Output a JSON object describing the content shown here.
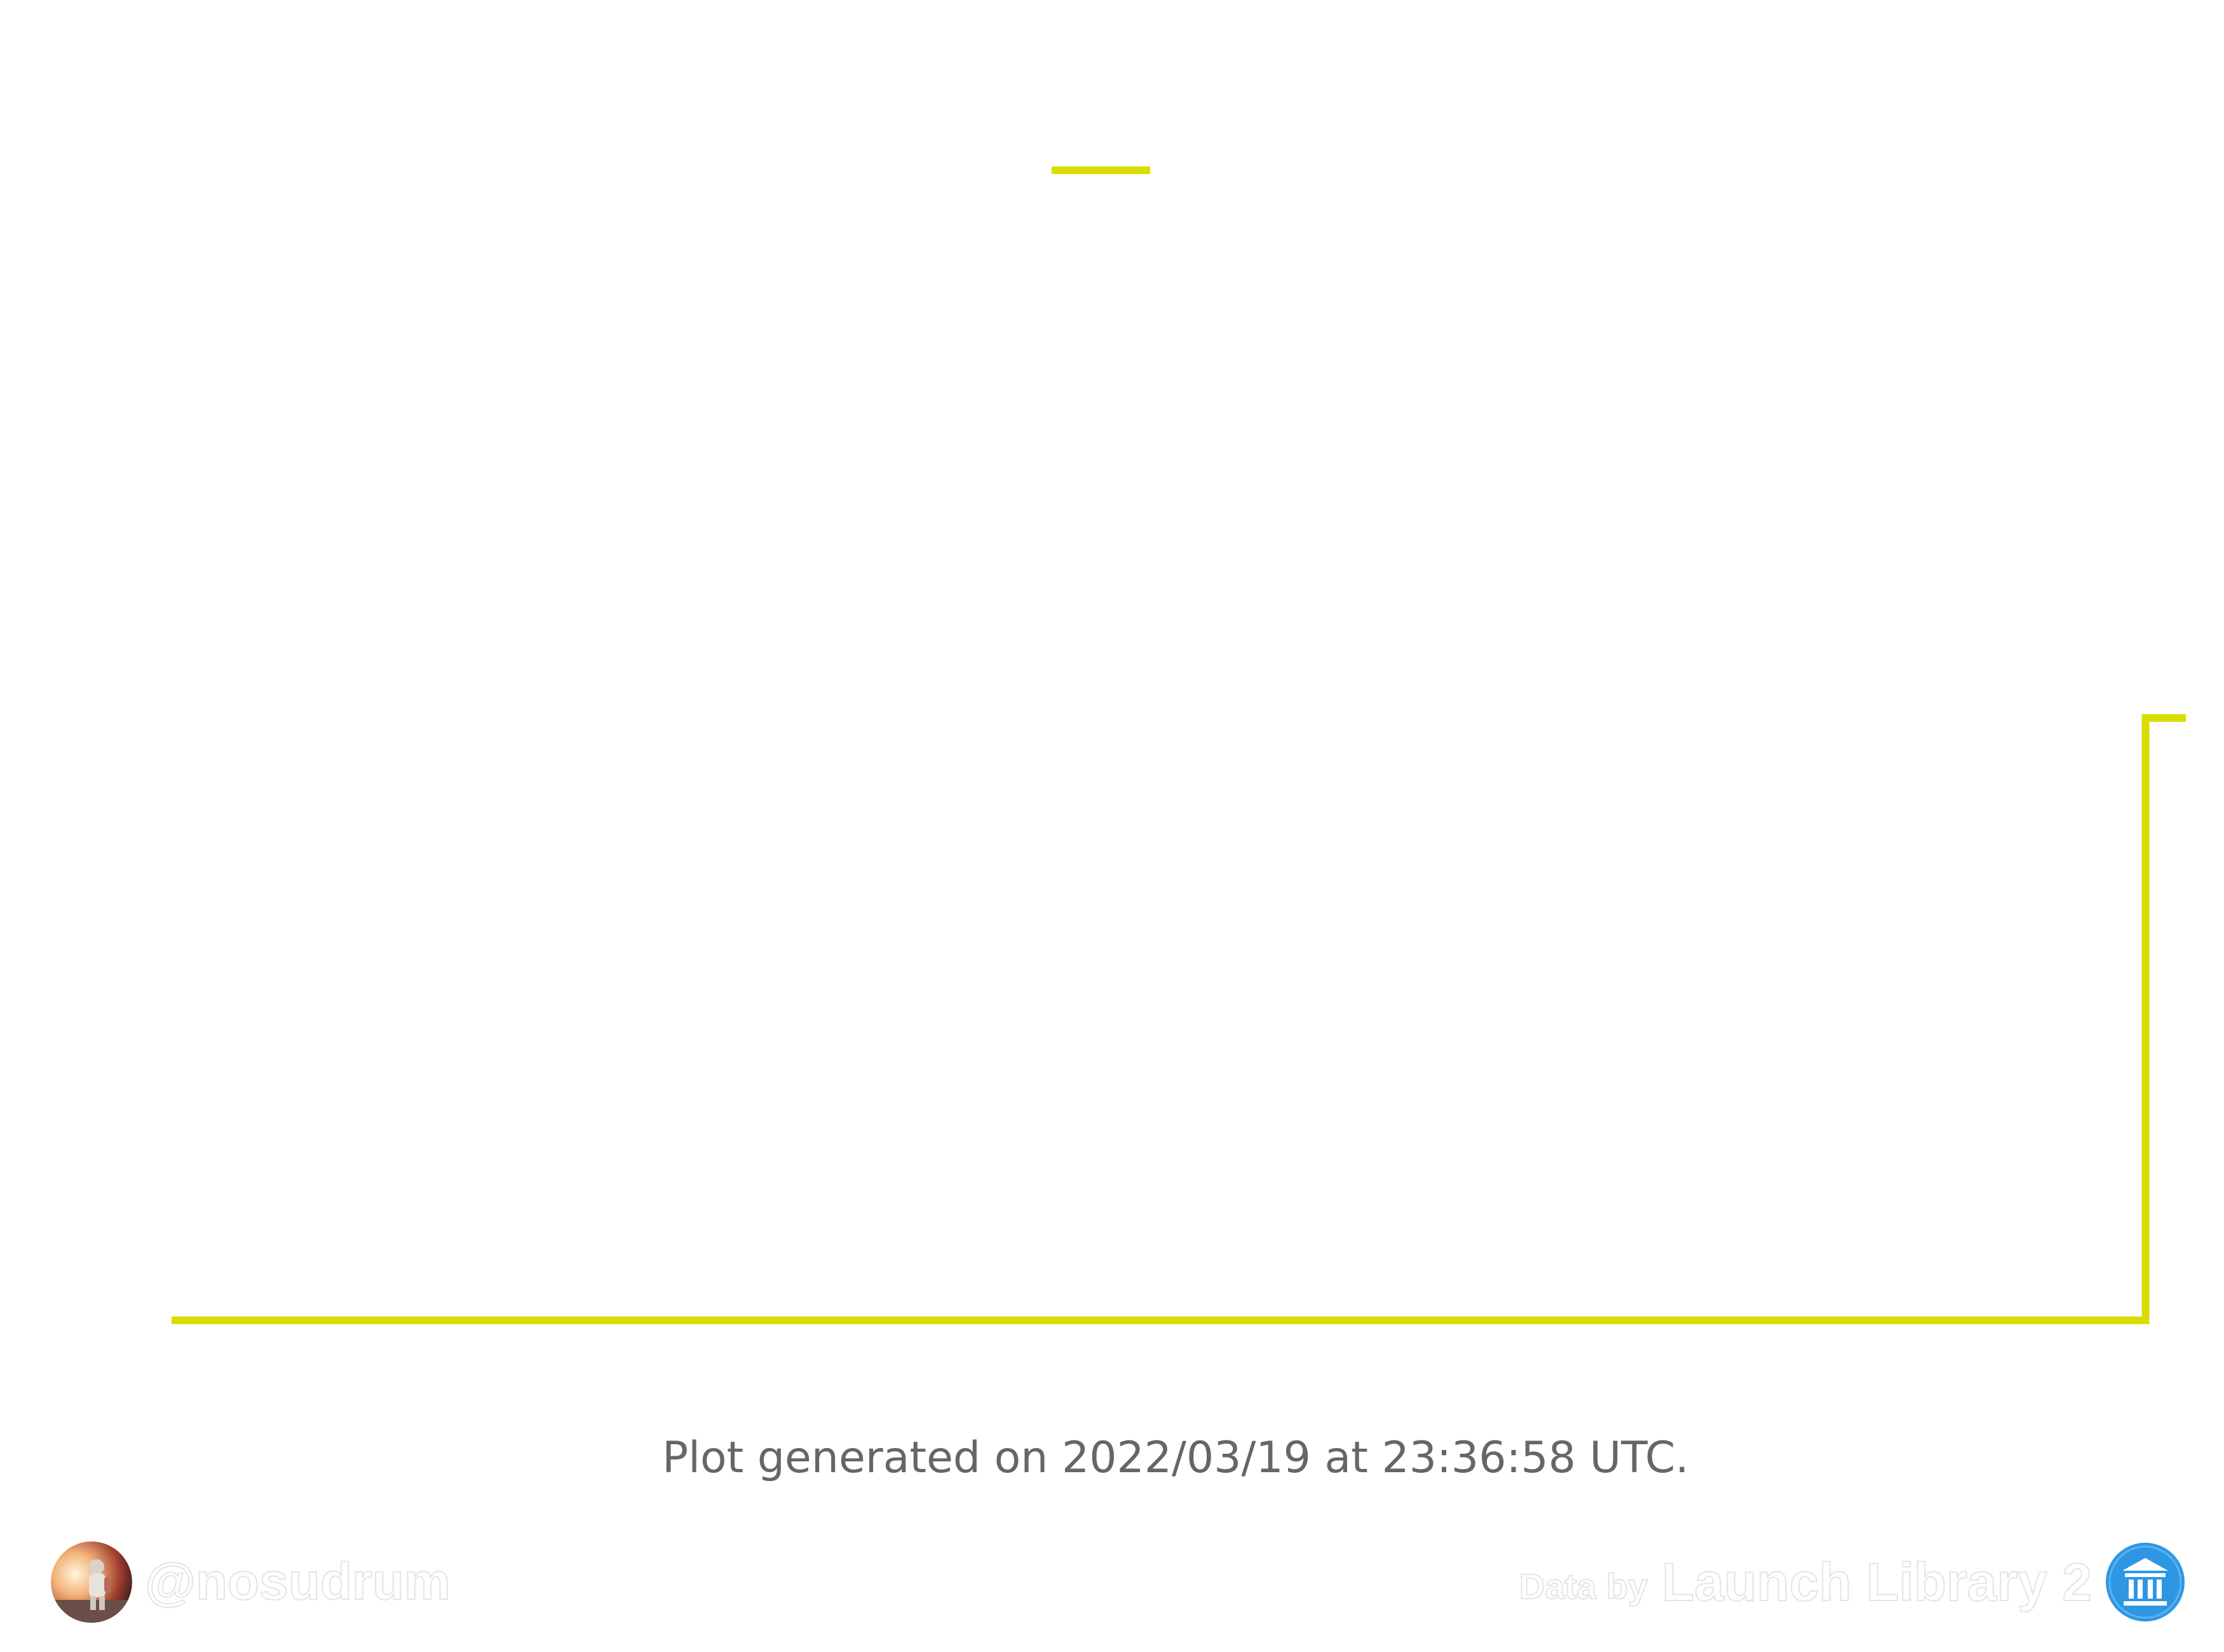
{
  "chart_data": {
    "type": "line",
    "title": "",
    "xlabel": "",
    "ylabel": "",
    "grid": false,
    "legend_position": "top-center",
    "series": [
      {
        "color": "#d9dd00",
        "x": [
          0,
          0.98,
          0.98,
          1.0
        ],
        "y": [
          0,
          0,
          1,
          1
        ]
      }
    ],
    "xlim": [
      0,
      1
    ],
    "ylim": [
      0,
      1
    ],
    "colors": {
      "series": "#d9dd00",
      "text": "#666666"
    }
  },
  "footer": {
    "generated_text": "Plot generated on 2022/03/19 at 23:36:58 UTC.",
    "author_handle": "@nosudrum",
    "credit_prefix": "Data by",
    "credit_name": "Launch Library 2"
  },
  "icons": {
    "avatar": "astronaut-avatar-icon",
    "logo": "launch-library-logo-icon"
  }
}
